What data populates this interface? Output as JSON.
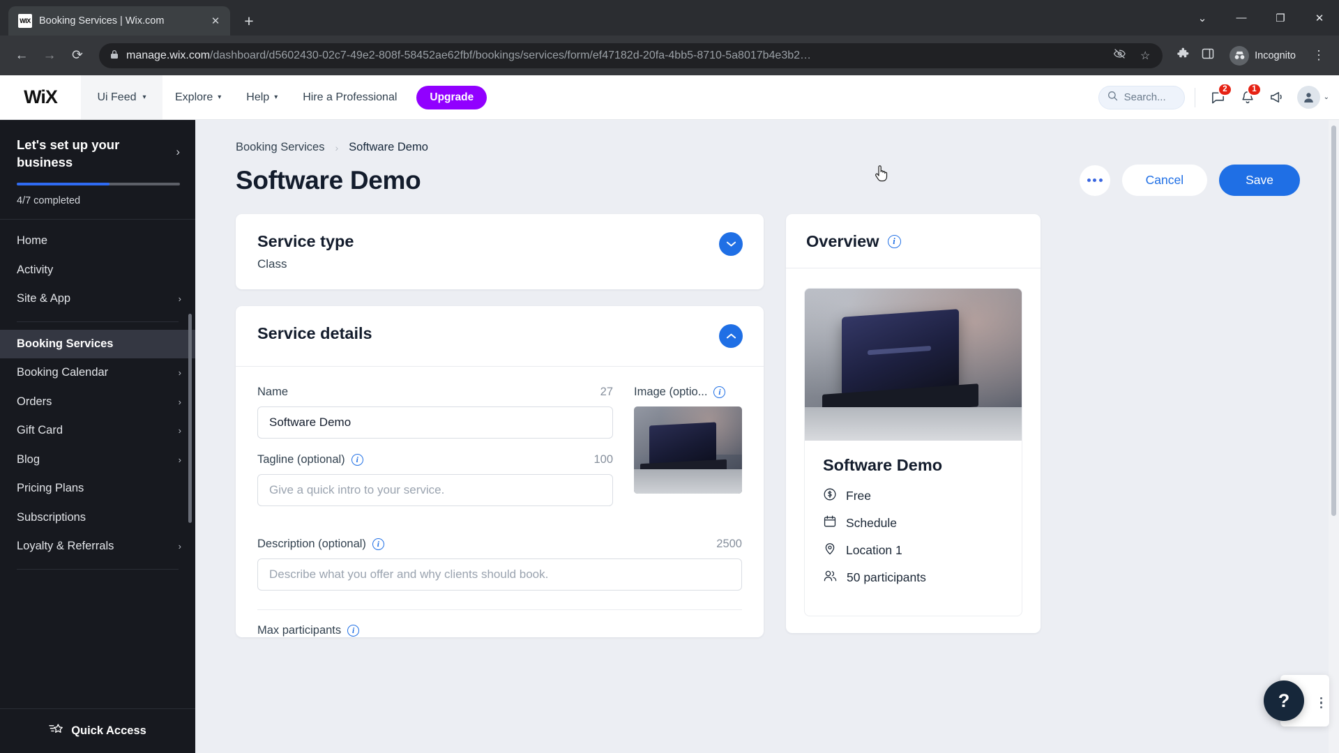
{
  "browser": {
    "tab": {
      "title": "Booking Services | Wix.com",
      "favicon_text": "WIX",
      "close_icon": "✕"
    },
    "new_tab_icon": "+",
    "window_controls": {
      "minimize_all": "⌄",
      "minimize": "—",
      "maximize": "❐",
      "close": "✕"
    },
    "toolbar": {
      "back_icon": "←",
      "forward_icon": "→",
      "reload_icon": "⟳",
      "lock_icon": "🔒",
      "url_domain": "manage.wix.com",
      "url_path": "/dashboard/d5602430-02c7-49e2-808f-58452ae62fbf/bookings/services/form/ef47182d-20fa-4bb5-8710-5a8017b4e3b2…",
      "hide_icon": "no-eye-icon",
      "bookmark_icon": "☆",
      "extensions_icon": "puzzle-icon",
      "sidepanel_icon": "panel-icon",
      "incognito_label": "Incognito",
      "menu_icon": "⋮"
    }
  },
  "wixbar": {
    "logo": "WiX",
    "site_selector": "Ui Feed",
    "nav": [
      {
        "label": "Explore",
        "has_chevron": true
      },
      {
        "label": "Help",
        "has_chevron": true
      },
      {
        "label": "Hire a Professional",
        "has_chevron": false
      }
    ],
    "upgrade_label": "Upgrade",
    "search_placeholder": "Search...",
    "chat_badge": "2",
    "bell_badge": "1",
    "chat_icon": "chat-icon",
    "bell_icon": "bell-icon",
    "megaphone_icon": "megaphone-icon",
    "avatar_icon": "user-avatar",
    "avatar_chevron": "⌄"
  },
  "sidebar": {
    "setup": {
      "title": "Let's set up your business",
      "arrow": "›",
      "progress_percent": 57,
      "status": "4/7 completed"
    },
    "items": [
      {
        "label": "Home",
        "arrow": "",
        "active": false
      },
      {
        "label": "Activity",
        "arrow": "",
        "active": false
      },
      {
        "label": "Site & App",
        "arrow": "›",
        "active": false
      },
      {
        "label": "Booking Services",
        "arrow": "",
        "active": true
      },
      {
        "label": "Booking Calendar",
        "arrow": "›",
        "active": false
      },
      {
        "label": "Orders",
        "arrow": "›",
        "active": false
      },
      {
        "label": "Gift Card",
        "arrow": "›",
        "active": false
      },
      {
        "label": "Blog",
        "arrow": "›",
        "active": false
      },
      {
        "label": "Pricing Plans",
        "arrow": "",
        "active": false
      },
      {
        "label": "Subscriptions",
        "arrow": "",
        "active": false
      },
      {
        "label": "Loyalty & Referrals",
        "arrow": "›",
        "active": false
      }
    ],
    "quick_access": {
      "label": "Quick Access",
      "icon": "star-lines-icon"
    }
  },
  "page": {
    "breadcrumb": {
      "parent": "Booking Services",
      "separator": "›",
      "current": "Software Demo"
    },
    "title": "Software Demo",
    "more_button": "more-options",
    "cancel_label": "Cancel",
    "save_label": "Save"
  },
  "service_type_card": {
    "title": "Service type",
    "value": "Class",
    "toggle_icon": "⌄"
  },
  "service_details_card": {
    "title": "Service details",
    "toggle_icon": "⌃",
    "name": {
      "label": "Name",
      "counter": "27",
      "value": "Software Demo"
    },
    "tagline": {
      "label": "Tagline (optional)",
      "counter": "100",
      "placeholder": "Give a quick intro to your service."
    },
    "description": {
      "label": "Description (optional)",
      "counter": "2500",
      "placeholder": "Describe what you offer and why clients should book."
    },
    "image": {
      "label": "Image (optio...",
      "info_icon": "info-icon"
    },
    "max_participants": {
      "label": "Max participants"
    }
  },
  "overview": {
    "title": "Overview",
    "info_icon": "info-icon",
    "service_name": "Software Demo",
    "rows": [
      {
        "icon": "dollar-circle-icon",
        "label": "Free"
      },
      {
        "icon": "calendar-icon",
        "label": "Schedule"
      },
      {
        "icon": "location-pin-icon",
        "label": "Location 1"
      },
      {
        "icon": "participants-icon",
        "label": "50 participants"
      }
    ]
  },
  "help": {
    "icon": "?",
    "label": "help-button"
  },
  "colors": {
    "accent_blue": "#1f6fe5",
    "upgrade_purple": "#9100ff",
    "badge_red": "#e62214",
    "sidebar_bg": "#17191f",
    "main_bg": "#eceef3"
  }
}
